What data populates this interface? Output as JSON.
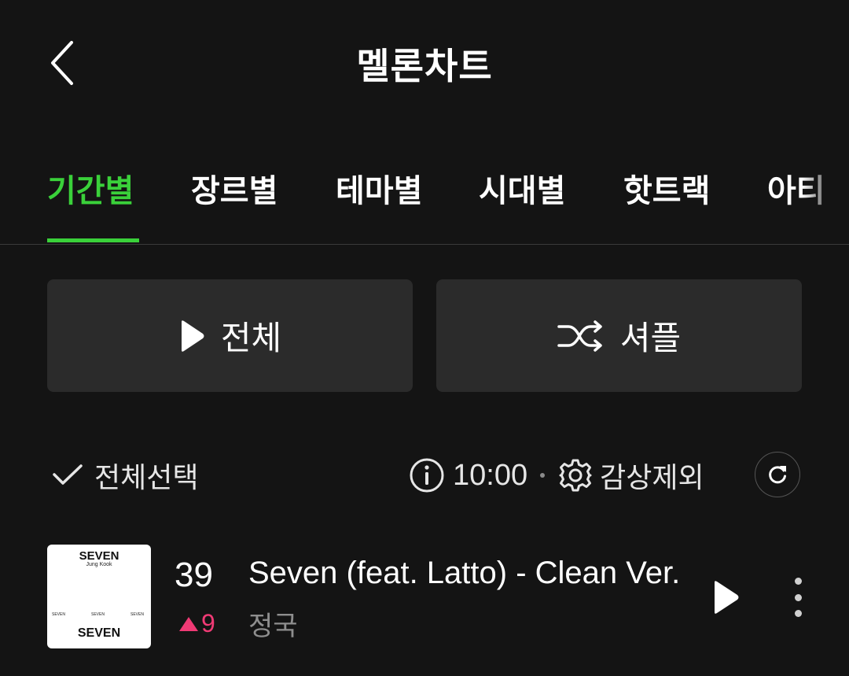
{
  "header": {
    "title": "멜론차트",
    "back_icon": "chevron-left-icon"
  },
  "tabs": [
    {
      "label": "기간별",
      "active": true
    },
    {
      "label": "장르별",
      "active": false
    },
    {
      "label": "테마별",
      "active": false
    },
    {
      "label": "시대별",
      "active": false
    },
    {
      "label": "핫트랙",
      "active": false
    },
    {
      "label": "아티",
      "active": false
    }
  ],
  "actions": {
    "play_all_label": "전체",
    "shuffle_label": "셔플"
  },
  "toolbar": {
    "select_all_label": "전체선택",
    "timer": "10:00",
    "exclude_label": "감상제외"
  },
  "songs": [
    {
      "rank": "39",
      "rank_change": "9",
      "rank_direction": "up",
      "title": "Seven (feat. Latto) - Clean Ver.",
      "artist": "정국",
      "album_art": {
        "title_top": "SEVEN",
        "artist_top": "Jung Kook",
        "title_bottom": "SEVEN"
      }
    }
  ],
  "colors": {
    "background": "#141414",
    "accent": "#3ad13a",
    "button_bg": "#2b2b2b",
    "rank_up": "#f03a75"
  }
}
